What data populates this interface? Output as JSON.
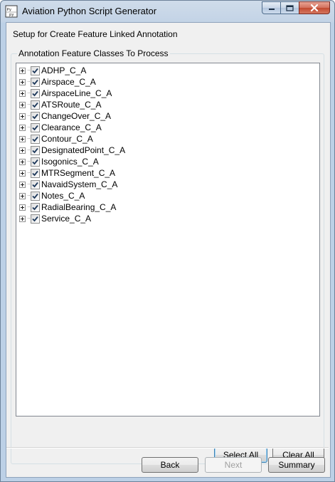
{
  "window": {
    "title": "Aviation Python Script Generator",
    "app_icon": "python-script-icon"
  },
  "heading": "Setup for Create Feature Linked Annotation",
  "group": {
    "legend": "Annotation Feature Classes To Process"
  },
  "tree": {
    "items": [
      {
        "label": "ADHP_C_A",
        "checked": true
      },
      {
        "label": "Airspace_C_A",
        "checked": true
      },
      {
        "label": "AirspaceLine_C_A",
        "checked": true
      },
      {
        "label": "ATSRoute_C_A",
        "checked": true
      },
      {
        "label": "ChangeOver_C_A",
        "checked": true
      },
      {
        "label": "Clearance_C_A",
        "checked": true
      },
      {
        "label": "Contour_C_A",
        "checked": true
      },
      {
        "label": "DesignatedPoint_C_A",
        "checked": true
      },
      {
        "label": "Isogonics_C_A",
        "checked": true
      },
      {
        "label": "MTRSegment_C_A",
        "checked": true
      },
      {
        "label": "NavaidSystem_C_A",
        "checked": true
      },
      {
        "label": "Notes_C_A",
        "checked": true
      },
      {
        "label": "RadialBearing_C_A",
        "checked": true
      },
      {
        "label": "Service_C_A",
        "checked": true
      }
    ]
  },
  "buttons": {
    "select_all": "Select All",
    "clear_all": "Clear All",
    "back": "Back",
    "next": "Next",
    "summary": "Summary"
  }
}
